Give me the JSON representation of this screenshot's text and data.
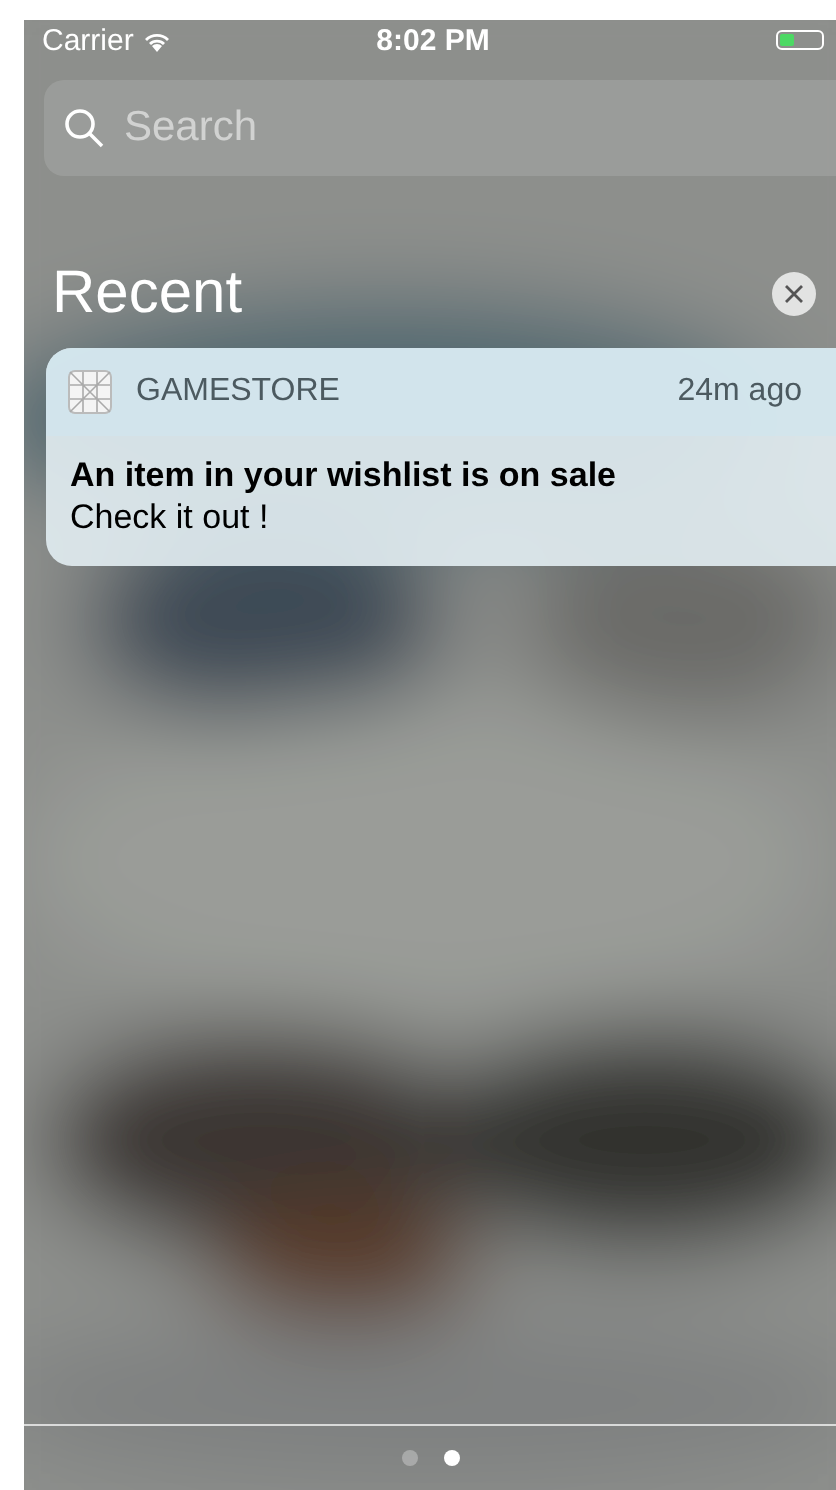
{
  "status_bar": {
    "carrier": "Carrier",
    "time": "8:02 PM"
  },
  "search": {
    "placeholder": "Search"
  },
  "section": {
    "title": "Recent"
  },
  "notifications": [
    {
      "app": "GAMESTORE",
      "time": "24m ago",
      "title": "An item in your wishlist is on sale",
      "body": "Check it out !"
    }
  ],
  "pages": [
    {
      "selected": false
    },
    {
      "selected": true
    }
  ]
}
